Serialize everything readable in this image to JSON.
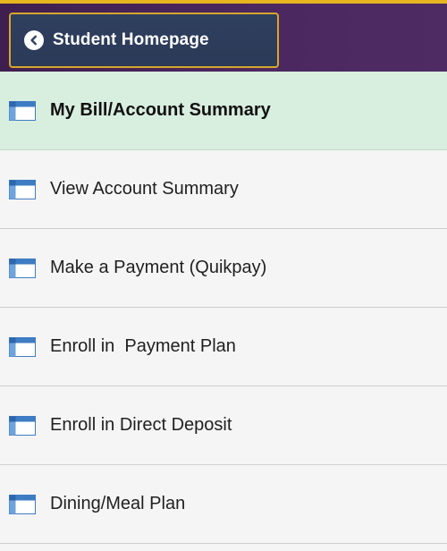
{
  "header": {
    "home_button_label": "Student Homepage",
    "back_icon": "chevron-left-circle-icon",
    "accent_color": "#e6b51f",
    "background_color": "#4c2860"
  },
  "menu": {
    "items": [
      {
        "label": "My Bill/Account Summary",
        "icon": "window-icon",
        "active": true
      },
      {
        "label": "View Account Summary",
        "icon": "window-icon",
        "active": false
      },
      {
        "label": "Make a Payment (Quikpay)",
        "icon": "window-icon",
        "active": false
      },
      {
        "label": "Enroll in  Payment Plan",
        "icon": "window-icon",
        "active": false
      },
      {
        "label": "Enroll in Direct Deposit",
        "icon": "window-icon",
        "active": false
      },
      {
        "label": "Dining/Meal Plan",
        "icon": "window-icon",
        "active": false
      }
    ],
    "active_color": "#d8eedf"
  }
}
